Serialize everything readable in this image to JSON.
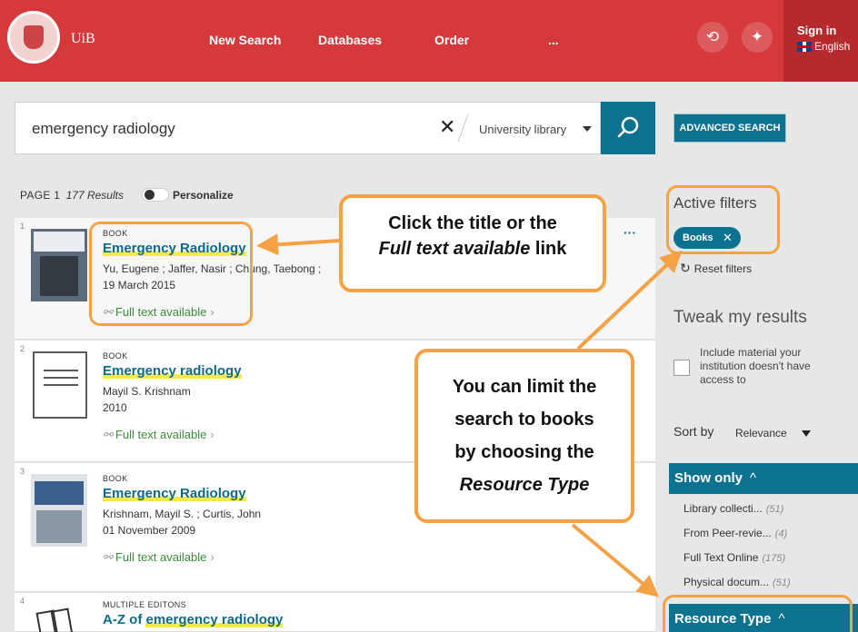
{
  "header": {
    "logo_text": "UiB",
    "nav": [
      "New Search",
      "Databases",
      "Order",
      "..."
    ],
    "sign_in": "Sign in",
    "language": "English"
  },
  "search": {
    "query": "emergency radiology",
    "scope": "University library",
    "advanced_label": "ADVANCED SEARCH"
  },
  "results_header": {
    "page": "PAGE 1",
    "count": "177 Results",
    "personalize": "Personalize"
  },
  "results": [
    {
      "index": "1",
      "type": "BOOK",
      "title": "Emergency Radiology",
      "authors": "Yu, Eugene ; Jaffer, Nasir ; Chung, Taebong ;",
      "date": "19 March 2015",
      "full_text": "Full text available"
    },
    {
      "index": "2",
      "type": "BOOK",
      "title": "Emergency radiology",
      "authors": "Mayil S. Krishnam",
      "date": "2010",
      "full_text": "Full text available"
    },
    {
      "index": "3",
      "type": "BOOK",
      "title": "Emergency Radiology",
      "authors": "Krishnam, Mayil S. ; Curtis, John",
      "date": "01 November 2009",
      "full_text": "Full text available"
    },
    {
      "index": "4",
      "type": "MULTIPLE EDITONS",
      "title_prefix": "A-Z of ",
      "title_highlight": "emergency radiology"
    }
  ],
  "sidebar": {
    "active_filters_label": "Active filters",
    "active_chip": "Books",
    "reset_label": "Reset filters",
    "tweak_label": "Tweak my results",
    "include_label": "Include material your institution doesn't have access to",
    "sort_label": "Sort by",
    "sort_value": "Relevance",
    "show_only_label": "Show only",
    "show_only_items": [
      {
        "label": "Library collecti...",
        "count": "(51)"
      },
      {
        "label": "From Peer-revie...",
        "count": "(4)"
      },
      {
        "label": "Full Text Online",
        "count": "(175)"
      },
      {
        "label": "Physical docum...",
        "count": "(51)"
      }
    ],
    "resource_type_label": "Resource Type"
  },
  "callouts": {
    "title_tip_line1": "Click the title or the",
    "title_tip_line2_italic": "Full text available",
    "title_tip_line2_rest": " link",
    "limit_tip_line1": "You can limit the",
    "limit_tip_line2": "search to books",
    "limit_tip_line3": "by choosing the",
    "limit_tip_line4_italic": "Resource Type"
  },
  "colors": {
    "header_red": "#d5393b",
    "accent_teal": "#0d7290",
    "callout_orange": "#f4a245",
    "link_green": "#3a8b3a",
    "highlight_yellow": "#f6e94e"
  }
}
